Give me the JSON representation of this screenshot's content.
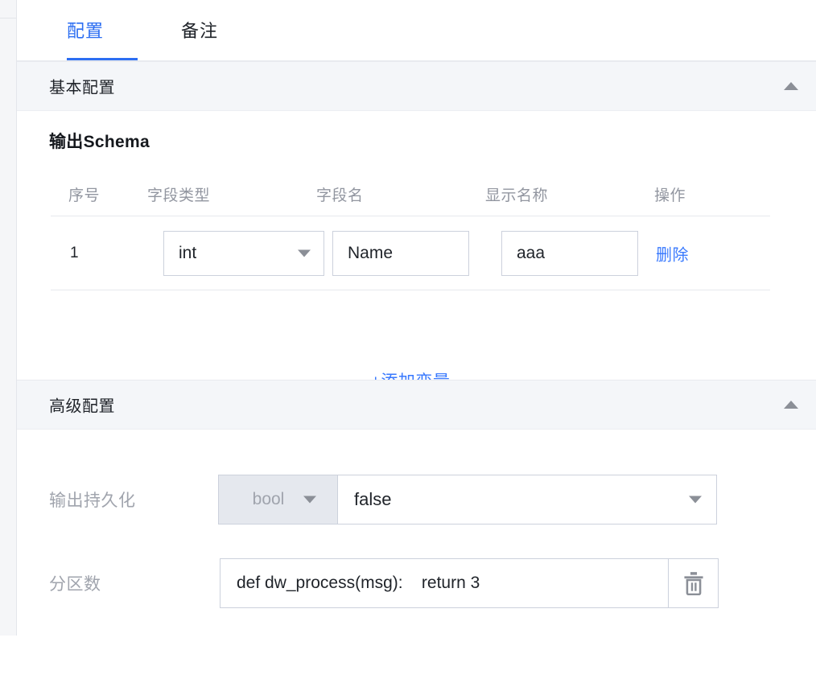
{
  "tabs": [
    {
      "label": "配置",
      "active": true
    },
    {
      "label": "备注",
      "active": false
    }
  ],
  "sections": {
    "basic": {
      "title": "基本配置",
      "collapse_icon": "triangle-up-icon",
      "schema": {
        "title": "输出Schema",
        "columns": [
          "序号",
          "字段类型",
          "字段名",
          "显示名称",
          "操作"
        ],
        "rows": [
          {
            "index": "1",
            "field_type": "int",
            "field_name": "Name",
            "display_name": "aaa",
            "operation": "删除"
          }
        ],
        "add_label": "+添加变量"
      }
    },
    "advanced": {
      "title": "高级配置",
      "collapse_icon": "triangle-up-icon",
      "fields": [
        {
          "label": "输出持久化",
          "type_addon": "bool",
          "value": "false"
        },
        {
          "label": "分区数",
          "value": "def dw_process(msg):    return 3",
          "action_icon": "trash-icon"
        }
      ]
    }
  },
  "colors": {
    "accent": "#2c6ef2",
    "link": "#3a7afe",
    "section_bg": "#f4f6f9",
    "border": "#ccd1dc",
    "muted_text": "#9296a0"
  }
}
